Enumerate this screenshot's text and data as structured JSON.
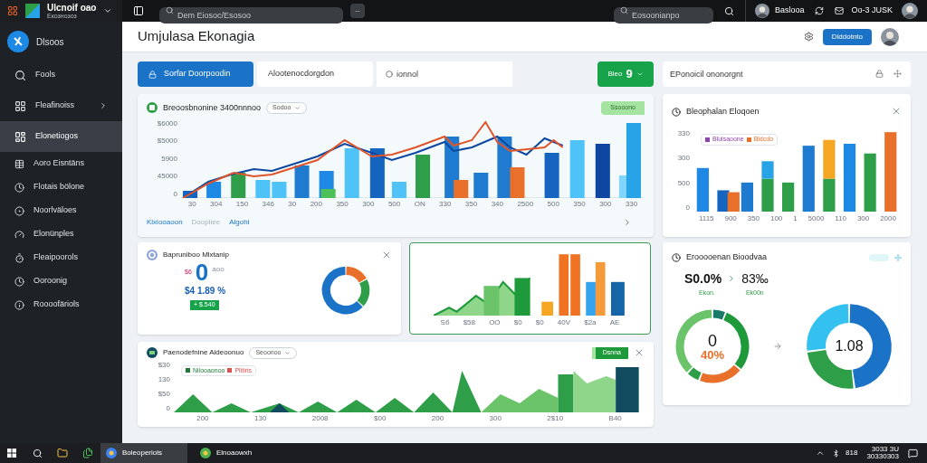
{
  "topbar": {
    "app_name": "Ulcnoif oao",
    "app_subtitle": "Eкознозоз",
    "search": {
      "placeholder": "Dem Eiosoc/Esosoo"
    },
    "more_button": "--",
    "search_right": {
      "placeholder": "Eosoonianpo"
    },
    "user_name": "Baslooa",
    "account": "Oo-3 JUSK"
  },
  "sidebar": {
    "brand": "Dlsoos",
    "items": [
      {
        "label": "Fools",
        "selected": false,
        "submenu": false
      },
      {
        "label": "Fleafinoiss",
        "selected": false,
        "submenu": true
      },
      {
        "label": "Elonetiogos",
        "selected": true,
        "submenu": false
      },
      {
        "label": "Aoro Eisntäns",
        "selected": false,
        "submenu": false
      },
      {
        "label": "Flotais bölone",
        "selected": false,
        "submenu": false
      },
      {
        "label": "Noorlväloes",
        "selected": false,
        "submenu": false
      },
      {
        "label": "Elonünples",
        "selected": false,
        "submenu": false
      },
      {
        "label": "Fleaipoorols",
        "selected": false,
        "submenu": false
      },
      {
        "label": "Ooroonig",
        "selected": false,
        "submenu": false
      },
      {
        "label": "Roooofäriols",
        "selected": false,
        "submenu": false
      }
    ]
  },
  "header": {
    "title": "Umjulasa Ekonagia",
    "button": "Dlddotnto"
  },
  "toolbar": {
    "tabs": [
      {
        "label": "Sorfar Doorpoodin",
        "selected": true
      },
      {
        "label": "Alootenocdorgdon",
        "selected": false
      }
    ],
    "filter": {
      "value": "ionnol"
    },
    "action": {
      "label": "Bleo",
      "count": "9"
    }
  },
  "side_field": {
    "value": "EPonoicil ononorgnt"
  },
  "main_chart": {
    "title": "Breoosbnonine 3400nnnoo",
    "dropdown": "Sodoo",
    "tag": "Ssooono",
    "y_ticks": [
      "$6000",
      "$5000",
      "5900",
      "45000",
      "0"
    ],
    "x_labels": [
      "30",
      "304",
      "150",
      "346",
      "30",
      "200",
      "350",
      "300",
      "500",
      "ON",
      "330",
      "350",
      "340",
      "2500",
      "500",
      "350",
      "300",
      "330"
    ],
    "legend": [
      {
        "label": "Klxiooaoon",
        "active": true
      },
      {
        "label": "Doopliee",
        "active": false
      },
      {
        "label": "Algohl",
        "active": true
      }
    ]
  },
  "right_chart": {
    "title": "Bleophalan Eloqoen",
    "legend": [
      {
        "label": "Bluisaoone",
        "color": "#8e44ad"
      },
      {
        "label": "Bldcdo",
        "color": "#e8702a"
      }
    ],
    "y_ticks": [
      "330",
      "300",
      "500",
      "0"
    ],
    "x_labels": [
      "1115",
      "900",
      "350",
      "100",
      "1",
      "5000",
      "110",
      "300",
      "2000"
    ]
  },
  "stat_card": {
    "title": "Bapruniboo Mlxtanip",
    "prefix": "$6",
    "value": "0",
    "unit": "aoo",
    "change": "$4 1.89 %",
    "badge": "+ $.540"
  },
  "mini_chart": {
    "x_labels": [
      "Sб",
      "$58",
      "OO",
      "$0",
      "$0",
      "40V",
      "$2a",
      "AE"
    ]
  },
  "gauge_card": {
    "title": "Erooooenan Bioodvaa",
    "primary": "S0.0%",
    "secondary": "83‰",
    "labels": [
      "Ekon.",
      "Ek00n"
    ],
    "gauge_value": "0",
    "gauge_pct": "40%",
    "donut_value": "1.08"
  },
  "bottom_chart": {
    "title": "Paenodefnine Aideoonuo",
    "dropdown": "Seoonoo",
    "tag": "Dsnna",
    "legend": [
      {
        "label": "Niiooaonoo",
        "color": "#1f7a3a"
      },
      {
        "label": "Plitiris",
        "color": "#d9534f"
      }
    ],
    "y_ticks": [
      "$30",
      "130",
      "$50",
      "0"
    ],
    "x_labels": [
      "200",
      "130",
      "2008",
      "$00",
      "200",
      "300",
      "2$10",
      "B40"
    ]
  },
  "taskbar": {
    "apps": [
      {
        "label": "Boleoperiols",
        "selected": true
      },
      {
        "label": "Elnoaowxh",
        "selected": false
      }
    ],
    "tray_value": "818",
    "clock": [
      "3033 3U",
      "30330303"
    ]
  }
}
